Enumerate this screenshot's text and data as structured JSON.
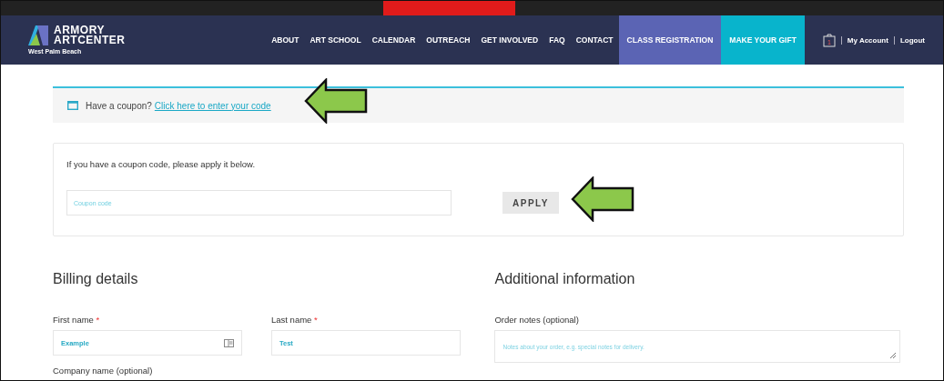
{
  "header": {
    "logo": {
      "line1": "ARMORY",
      "line2": "ARTCENTER",
      "tagline": "West Palm Beach"
    },
    "nav": [
      {
        "label": "ABOUT",
        "kind": "link"
      },
      {
        "label": "ART SCHOOL",
        "kind": "link"
      },
      {
        "label": "CALENDAR",
        "kind": "link"
      },
      {
        "label": "OUTREACH",
        "kind": "link"
      },
      {
        "label": "GET INVOLVED",
        "kind": "link"
      },
      {
        "label": "FAQ",
        "kind": "link"
      },
      {
        "label": "CONTACT",
        "kind": "link"
      },
      {
        "label": "CLASS REGISTRATION",
        "kind": "highlight",
        "color": "#5b64b4"
      },
      {
        "label": "MAKE YOUR GIFT",
        "kind": "highlight",
        "color": "#08b4cc"
      }
    ],
    "cart": {
      "count": "1"
    },
    "account_links": [
      "My Account",
      "Logout"
    ]
  },
  "coupon_notice": {
    "text": "Have a coupon?",
    "link": "Click here to enter your code"
  },
  "coupon_form": {
    "hint": "If you have a coupon code, please apply it below.",
    "placeholder": "Coupon code",
    "button": "APPLY"
  },
  "billing": {
    "title": "Billing details",
    "fields": [
      {
        "label": "First name",
        "required_mark": "*",
        "value": "Example",
        "contact_icon": true
      },
      {
        "label": "Last name",
        "required_mark": "*",
        "value": "Test",
        "contact_icon": false
      }
    ],
    "next_label": "Company name (optional)"
  },
  "additional": {
    "title": "Additional information",
    "notes_label": "Order notes (optional)",
    "notes_placeholder": "Notes about your order, e.g. special notes for delivery."
  }
}
